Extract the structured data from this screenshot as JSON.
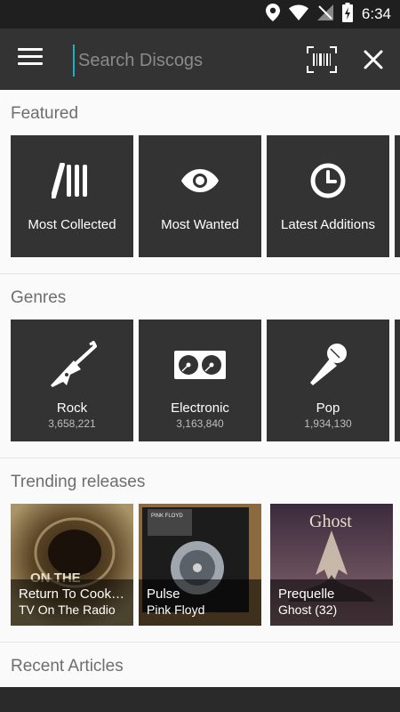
{
  "status_bar": {
    "time": "6:34"
  },
  "toolbar": {
    "search_placeholder": "Search Discogs"
  },
  "featured": {
    "title": "Featured",
    "items": [
      {
        "label": "Most Collected",
        "icon": "records-stack-icon"
      },
      {
        "label": "Most Wanted",
        "icon": "eye-icon"
      },
      {
        "label": "Latest Additions",
        "icon": "clock-icon"
      }
    ]
  },
  "genres": {
    "title": "Genres",
    "items": [
      {
        "label": "Rock",
        "count": "3,658,221",
        "icon": "guitar-icon"
      },
      {
        "label": "Electronic",
        "count": "3,163,840",
        "icon": "turntable-icon"
      },
      {
        "label": "Pop",
        "count": "1,934,130",
        "icon": "microphone-icon"
      }
    ]
  },
  "trending": {
    "title": "Trending releases",
    "items": [
      {
        "title": "Return To Cookie...",
        "artist": "TV On The Radio",
        "accent": "#8a7a52"
      },
      {
        "title": "Pulse",
        "artist": "Pink Floyd",
        "accent": "#6b5a3a"
      },
      {
        "title": "Prequelle",
        "artist": "Ghost (32)",
        "accent": "#7a5a6a"
      }
    ]
  },
  "articles": {
    "title": "Recent Articles"
  },
  "colors": {
    "accent": "#19b3c4",
    "tile": "#333333",
    "toolbar": "#333333"
  }
}
